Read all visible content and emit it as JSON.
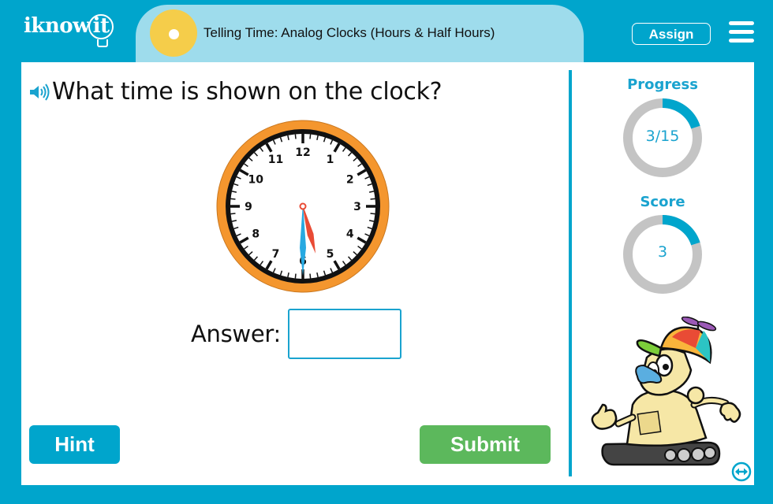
{
  "header": {
    "logo_prefix": "iknow",
    "logo_bulb": "it",
    "title": "Telling Time: Analog Clocks (Hours & Half Hours)",
    "assign_label": "Assign",
    "menu_icon": "hamburger-menu-icon"
  },
  "question": {
    "speaker_icon": "speaker-icon",
    "text": "What time is shown on the clock?"
  },
  "clock": {
    "hour": 5,
    "minute": 30,
    "numbers": [
      "12",
      "1",
      "2",
      "3",
      "4",
      "5",
      "6",
      "7",
      "8",
      "9",
      "10",
      "11"
    ],
    "colors": {
      "rim": "#f4962e",
      "hour_hand": "#e94b35",
      "minute_hand": "#27a9e1",
      "face": "#ffffff",
      "ticks": "#111111"
    }
  },
  "answer": {
    "label": "Answer:",
    "value": "",
    "placeholder": ""
  },
  "buttons": {
    "hint_label": "Hint",
    "submit_label": "Submit"
  },
  "sidebar": {
    "progress": {
      "label": "Progress",
      "value_text": "3/15",
      "fraction": 0.2
    },
    "score": {
      "label": "Score",
      "value_text": "3",
      "fraction": 0.2
    },
    "mascot": "robot-mascot",
    "swap_icon": "swap-arrows-icon"
  },
  "colors": {
    "brand": "#00a5cc",
    "title_pill": "#9edcec",
    "sun": "#f5cd4a",
    "hint": "#00a5cc",
    "submit": "#5cb85c",
    "ring_track": "#c4c4c4",
    "ring_fill": "#00a5cc"
  }
}
